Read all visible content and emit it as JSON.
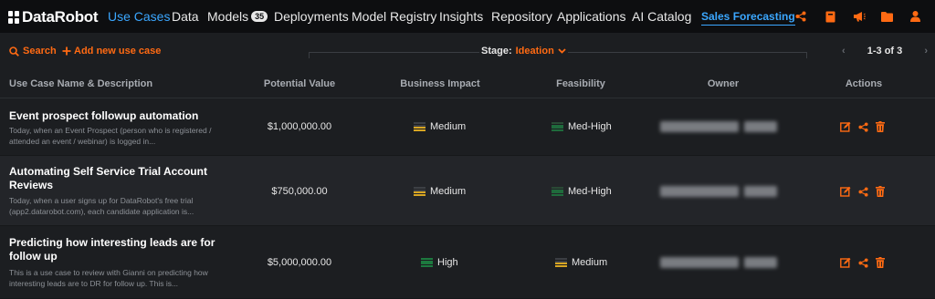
{
  "nav": {
    "logo_a": "Data",
    "logo_b": "Robot",
    "items": [
      {
        "label": "Use Cases",
        "active": true
      },
      {
        "label": "Data"
      },
      {
        "label": "Models",
        "badge": "35"
      },
      {
        "label": "Deployments"
      },
      {
        "label": "Model Registry"
      },
      {
        "label": "Insights"
      },
      {
        "label": "Repository"
      },
      {
        "label": "Applications"
      },
      {
        "label": "AI Catalog"
      }
    ],
    "project": "Sales Forecasting",
    "icons": [
      "share-icon",
      "book-icon",
      "megaphone-icon",
      "folder-icon",
      "user-icon"
    ],
    "accent": "#ff6a13",
    "link_color": "#3ba7ff"
  },
  "toolbar": {
    "search_label": "Search",
    "add_label": "Add new use case",
    "stage_label": "Stage:",
    "stage_value": "Ideation",
    "pager_prev": "‹",
    "pager_count": "1-3 of 3",
    "pager_next": "›"
  },
  "table": {
    "columns": [
      "Use Case Name & Description",
      "Potential Value",
      "Business Impact",
      "Feasibility",
      "Owner",
      "Actions"
    ],
    "rows": [
      {
        "name": "Event prospect followup automation",
        "description": "Today, when an Event Prospect (person who is registered / attended an event / webinar) is logged in...",
        "value": "$1,000,000.00",
        "impact": "Medium",
        "feasibility": "Med-High"
      },
      {
        "name": "Automating Self Service Trial Account Reviews",
        "description": "Today, when a user signs up for DataRobot's free trial (app2.datarobot.com), each candidate application is...",
        "value": "$750,000.00",
        "impact": "Medium",
        "feasibility": "Med-High"
      },
      {
        "name": "Predicting how interesting leads are for follow up",
        "description": "This is a use case to review with Gianni on predicting how interesting leads are to DR for follow up. This is...",
        "value": "$5,000,000.00",
        "impact": "High",
        "feasibility": "Medium"
      }
    ],
    "action_icons": [
      "edit-icon",
      "share-icon",
      "trash-icon"
    ]
  }
}
